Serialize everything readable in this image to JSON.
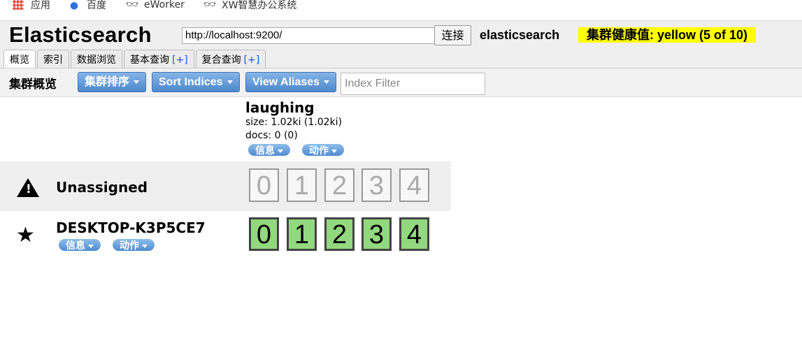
{
  "bookmarks": [
    {
      "label": "应用",
      "icon": "apps-icon"
    },
    {
      "label": "百度",
      "icon": "baidu-icon"
    },
    {
      "label": "eWorker",
      "icon": "glasses-icon"
    },
    {
      "label": "XW智慧办公系统",
      "icon": "glasses-icon"
    }
  ],
  "header": {
    "brand": "Elasticsearch",
    "url": "http://localhost:9200/",
    "connect_label": "连接",
    "cluster_name": "elasticsearch",
    "health": "集群健康值: yellow (5 of 10)",
    "health_color": "#ffff00"
  },
  "tabs": [
    {
      "label": "概览",
      "plus": ""
    },
    {
      "label": "索引",
      "plus": ""
    },
    {
      "label": "数据浏览",
      "plus": ""
    },
    {
      "label": "基本查询",
      "plus": "[+]"
    },
    {
      "label": "复合查询",
      "plus": "[+]"
    }
  ],
  "toolbar": {
    "title": "集群概览",
    "sort_cluster": "集群排序",
    "sort_indices": "Sort Indices",
    "view_aliases": "View Aliases",
    "filter_placeholder": "Index Filter"
  },
  "index": {
    "name": "laughing",
    "size": "size: 1.02ki (1.02ki)",
    "docs": "docs: 0 (0)",
    "info_label": "信息",
    "action_label": "动作"
  },
  "unassigned": {
    "label": "Unassigned",
    "shards": [
      "0",
      "1",
      "2",
      "3",
      "4"
    ]
  },
  "node": {
    "label": "DESKTOP-K3P5CE7",
    "info_label": "信息",
    "action_label": "动作",
    "shards": [
      "0",
      "1",
      "2",
      "3",
      "4"
    ],
    "shard_color": "#93d87f"
  }
}
